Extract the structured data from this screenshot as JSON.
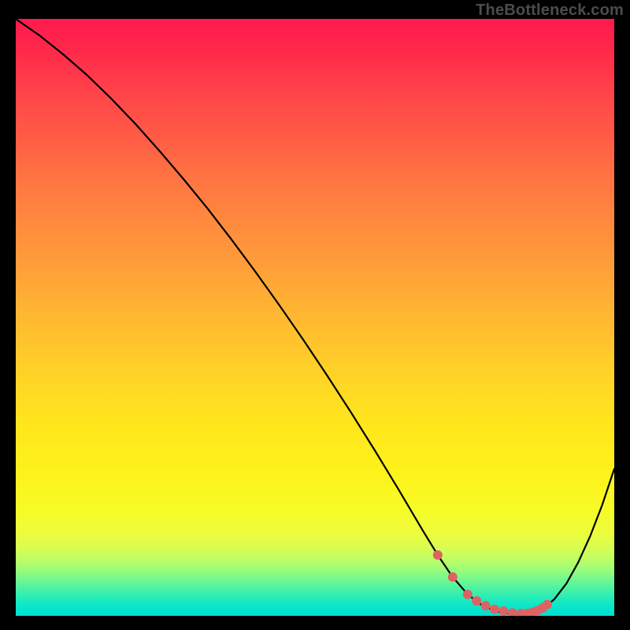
{
  "watermark": "TheBottleneck.com",
  "chart_data": {
    "type": "line",
    "title": "",
    "xlabel": "",
    "ylabel": "",
    "xlim": [
      0,
      100
    ],
    "ylim": [
      0,
      100
    ],
    "grid": false,
    "legend": false,
    "series": [
      {
        "name": "bottleneck-curve",
        "x": [
          0,
          4,
          8,
          12,
          16,
          20,
          24,
          28,
          32,
          36,
          40,
          44,
          48,
          52,
          56,
          60,
          64,
          68,
          70.5,
          73,
          75.5,
          78,
          80.5,
          83,
          85.5,
          87,
          88.4,
          90,
          92,
          94,
          96,
          98,
          100
        ],
        "y": [
          100,
          97.2,
          94.0,
          90.5,
          86.6,
          82.4,
          77.9,
          73.2,
          68.3,
          63.1,
          57.7,
          52.1,
          46.3,
          40.3,
          34.1,
          27.7,
          21.1,
          14.3,
          10.2,
          6.5,
          3.6,
          1.7,
          0.7,
          0.3,
          0.3,
          0.7,
          1.4,
          2.8,
          5.4,
          9.0,
          13.4,
          18.6,
          24.6
        ]
      }
    ],
    "markers": {
      "name": "highlighted-dots",
      "color": "#de6262",
      "x": [
        70.5,
        73.0,
        75.5,
        77.0,
        78.5,
        80.0,
        81.5,
        83.0,
        84.5,
        85.5,
        86.3,
        87.2,
        88.0,
        88.8
      ],
      "y": [
        10.2,
        6.5,
        3.6,
        2.5,
        1.7,
        1.1,
        0.8,
        0.5,
        0.4,
        0.4,
        0.6,
        0.9,
        1.3,
        1.9
      ]
    },
    "background_gradient": {
      "orientation": "vertical",
      "stops": [
        {
          "pos": 0.0,
          "color": "#ff1a4d"
        },
        {
          "pos": 0.25,
          "color": "#ff6f44"
        },
        {
          "pos": 0.5,
          "color": "#ffc12c"
        },
        {
          "pos": 0.75,
          "color": "#fdf21a"
        },
        {
          "pos": 0.92,
          "color": "#7cf98a"
        },
        {
          "pos": 1.0,
          "color": "#00e0d6"
        }
      ]
    }
  }
}
